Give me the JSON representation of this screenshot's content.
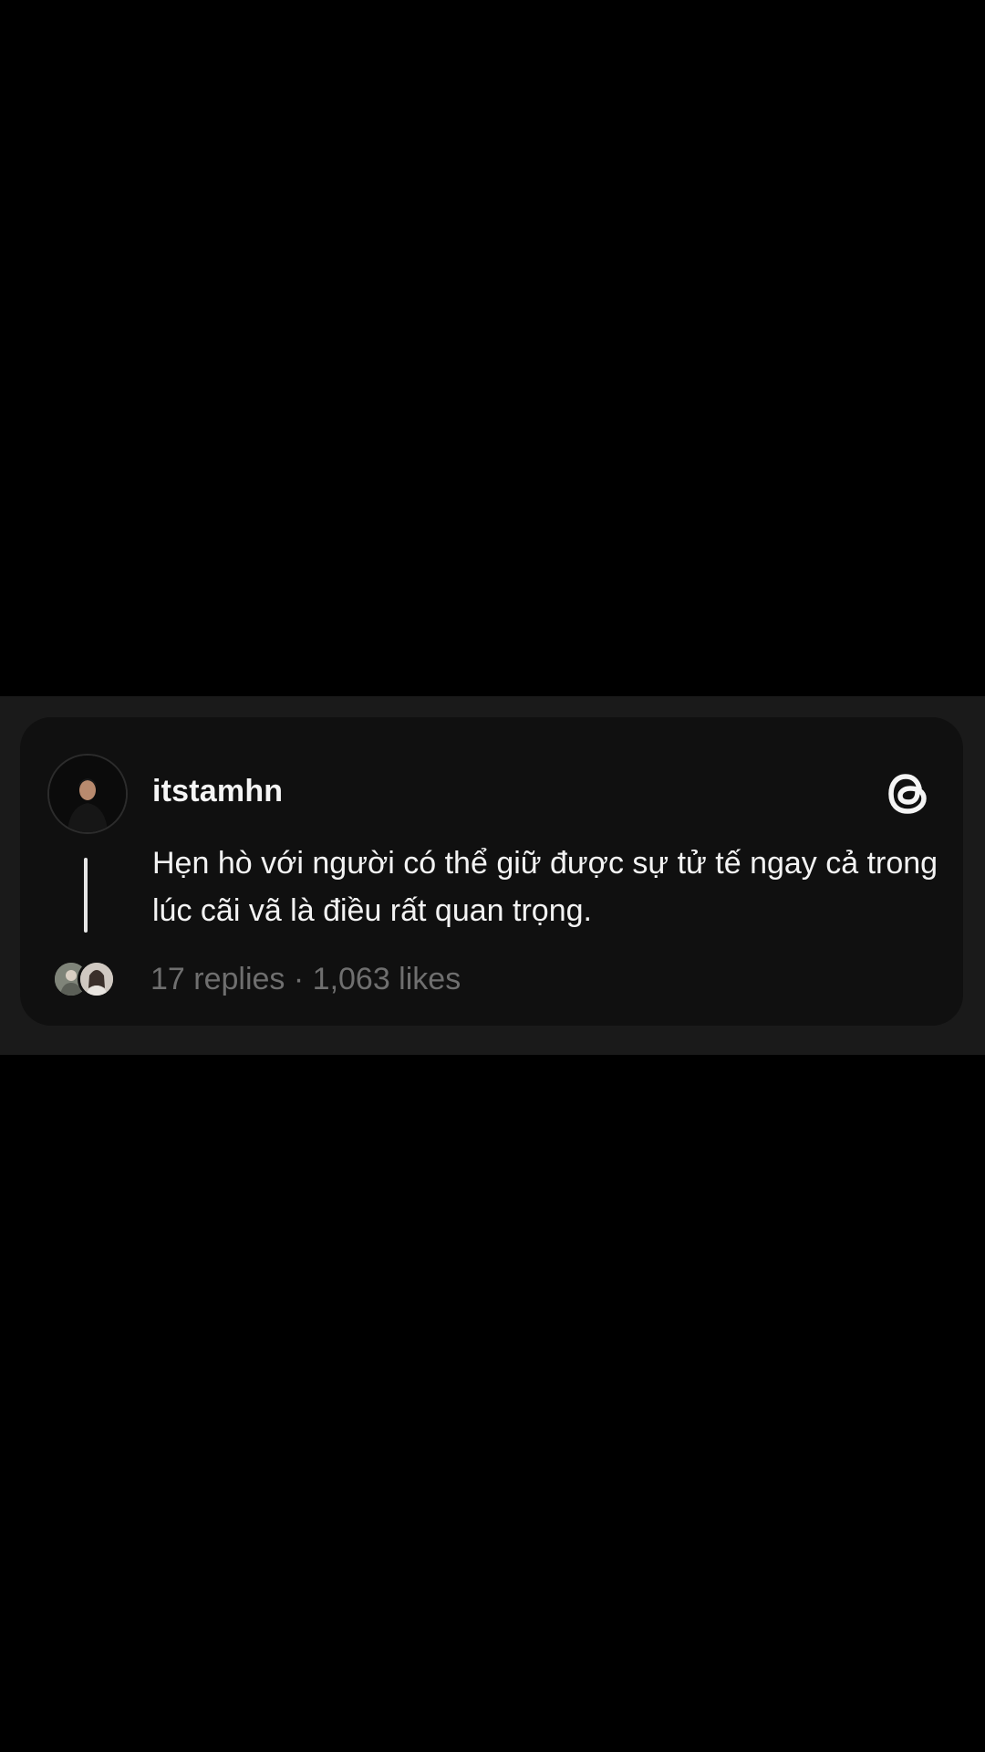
{
  "post": {
    "username": "itstamhn",
    "text": "Hẹn hò với người có thể giữ được sự tử tế ngay cả trong lúc cãi vã là điều rất quan trọng.",
    "replies": "17 replies",
    "separator": "·",
    "likes": "1,063 likes"
  },
  "icons": {
    "brand": "threads-logo-icon",
    "avatar": "user-avatar",
    "reply_avatars": [
      "reply-avatar-1",
      "reply-avatar-2"
    ]
  },
  "colors": {
    "background": "#000000",
    "band": "#1a1a1a",
    "card": "#101010",
    "text": "#f3f3f3",
    "muted": "#6f6f6f"
  }
}
